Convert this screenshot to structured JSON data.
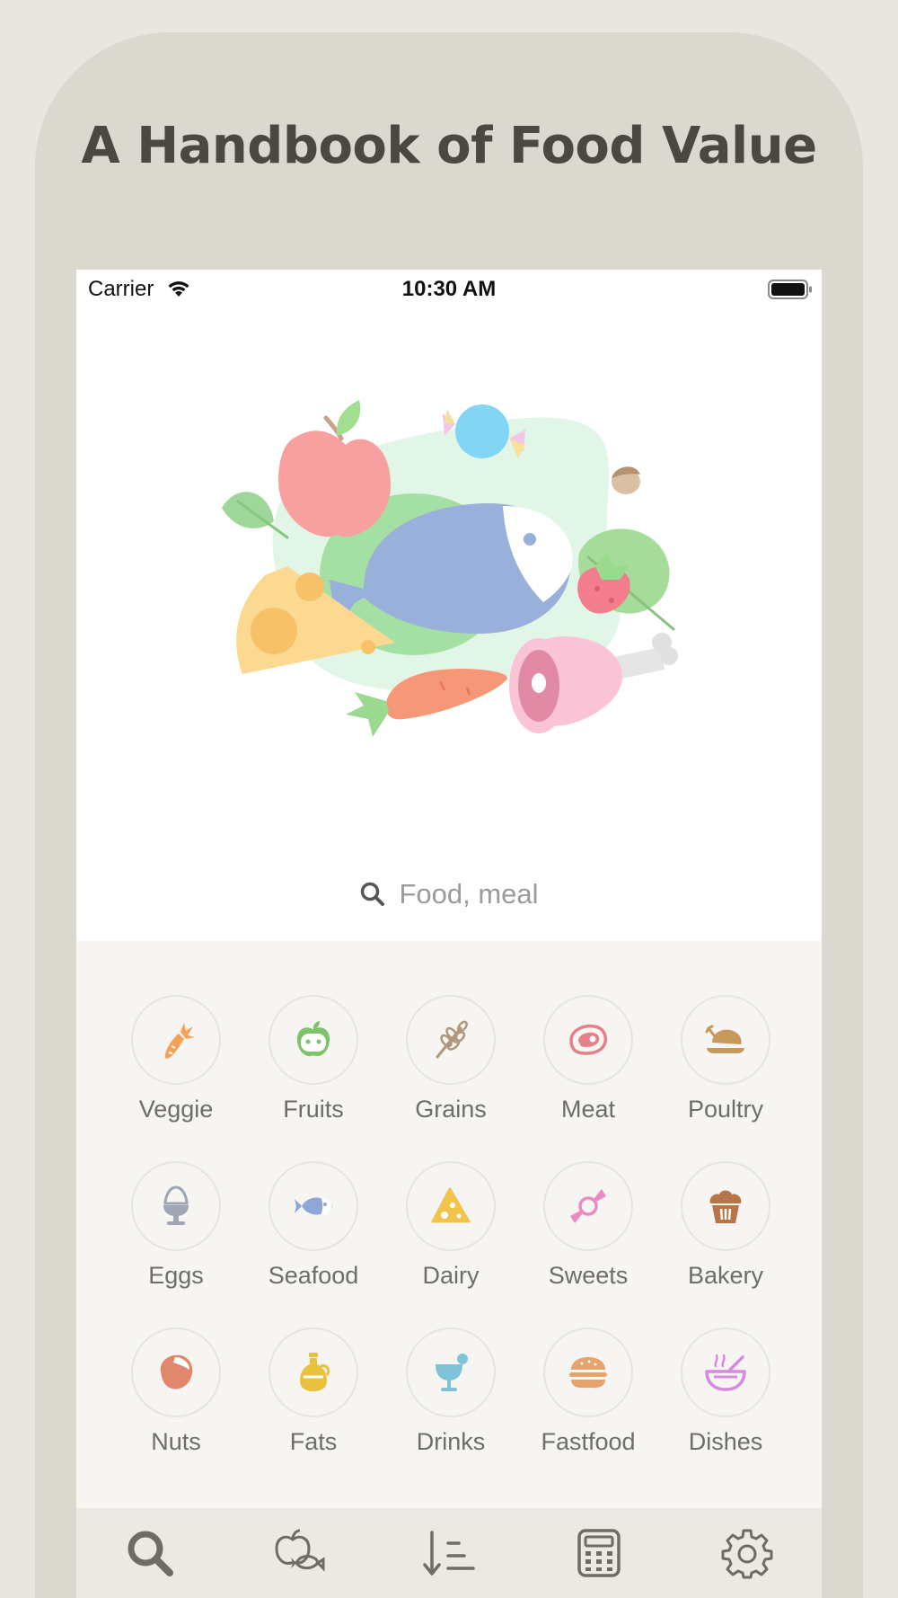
{
  "headline": "A Handbook of Food Value",
  "status_bar": {
    "carrier": "Carrier",
    "time": "10:30 AM"
  },
  "search": {
    "placeholder": "Food, meal"
  },
  "categories": [
    {
      "label": "Veggie",
      "icon": "carrot-icon",
      "color": "#f4a25a"
    },
    {
      "label": "Fruits",
      "icon": "apple-icon",
      "color": "#7cc36a"
    },
    {
      "label": "Grains",
      "icon": "wheat-icon",
      "color": "#b0967a"
    },
    {
      "label": "Meat",
      "icon": "steak-icon",
      "color": "#e57f8a"
    },
    {
      "label": "Poultry",
      "icon": "chicken-icon",
      "color": "#c79a5c"
    },
    {
      "label": "Eggs",
      "icon": "egg-cup-icon",
      "color": "#9ea5b4"
    },
    {
      "label": "Seafood",
      "icon": "fish-icon",
      "color": "#8ea6d8"
    },
    {
      "label": "Dairy",
      "icon": "cheese-icon",
      "color": "#f2c54a"
    },
    {
      "label": "Sweets",
      "icon": "candy-icon",
      "color": "#e98bc5"
    },
    {
      "label": "Bakery",
      "icon": "muffin-icon",
      "color": "#b7754a"
    },
    {
      "label": "Nuts",
      "icon": "hazelnut-icon",
      "color": "#e0876d"
    },
    {
      "label": "Fats",
      "icon": "oil-bottle-icon",
      "color": "#e8c13d"
    },
    {
      "label": "Drinks",
      "icon": "cocktail-icon",
      "color": "#7fc4d6"
    },
    {
      "label": "Fastfood",
      "icon": "burger-icon",
      "color": "#e8a36c"
    },
    {
      "label": "Dishes",
      "icon": "soup-bowl-icon",
      "color": "#d78be0"
    }
  ],
  "tabbar": [
    {
      "icon": "search-icon",
      "active": true
    },
    {
      "icon": "food-diary-icon",
      "active": false
    },
    {
      "icon": "sort-list-icon",
      "active": false
    },
    {
      "icon": "calculator-icon",
      "active": false
    },
    {
      "icon": "gear-icon",
      "active": false
    }
  ]
}
